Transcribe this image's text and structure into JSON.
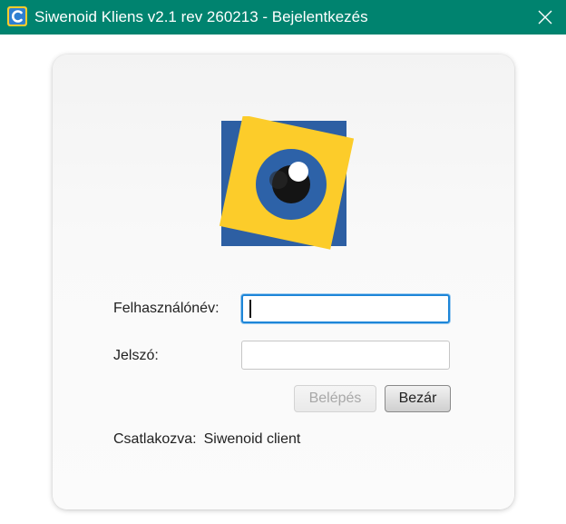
{
  "window": {
    "title": "Siwenoid Kliens v2.1 rev 260213 - Bejelentkezés",
    "icon": "app-logo-icon",
    "close_icon": "close-icon"
  },
  "login": {
    "logo_icon": "eye-logo-icon",
    "username_label": "Felhasználónév:",
    "username_value": "",
    "password_label": "Jelszó:",
    "password_value": "",
    "login_button": "Belépés",
    "close_button": "Bezár",
    "status_label": "Csatlakozva:",
    "status_value": "Siwenoid client"
  },
  "colors": {
    "titlebar": "#00836f",
    "focus": "#1e86d8",
    "logo_blue": "#2d5fa3",
    "logo_yellow": "#fccc2a"
  }
}
